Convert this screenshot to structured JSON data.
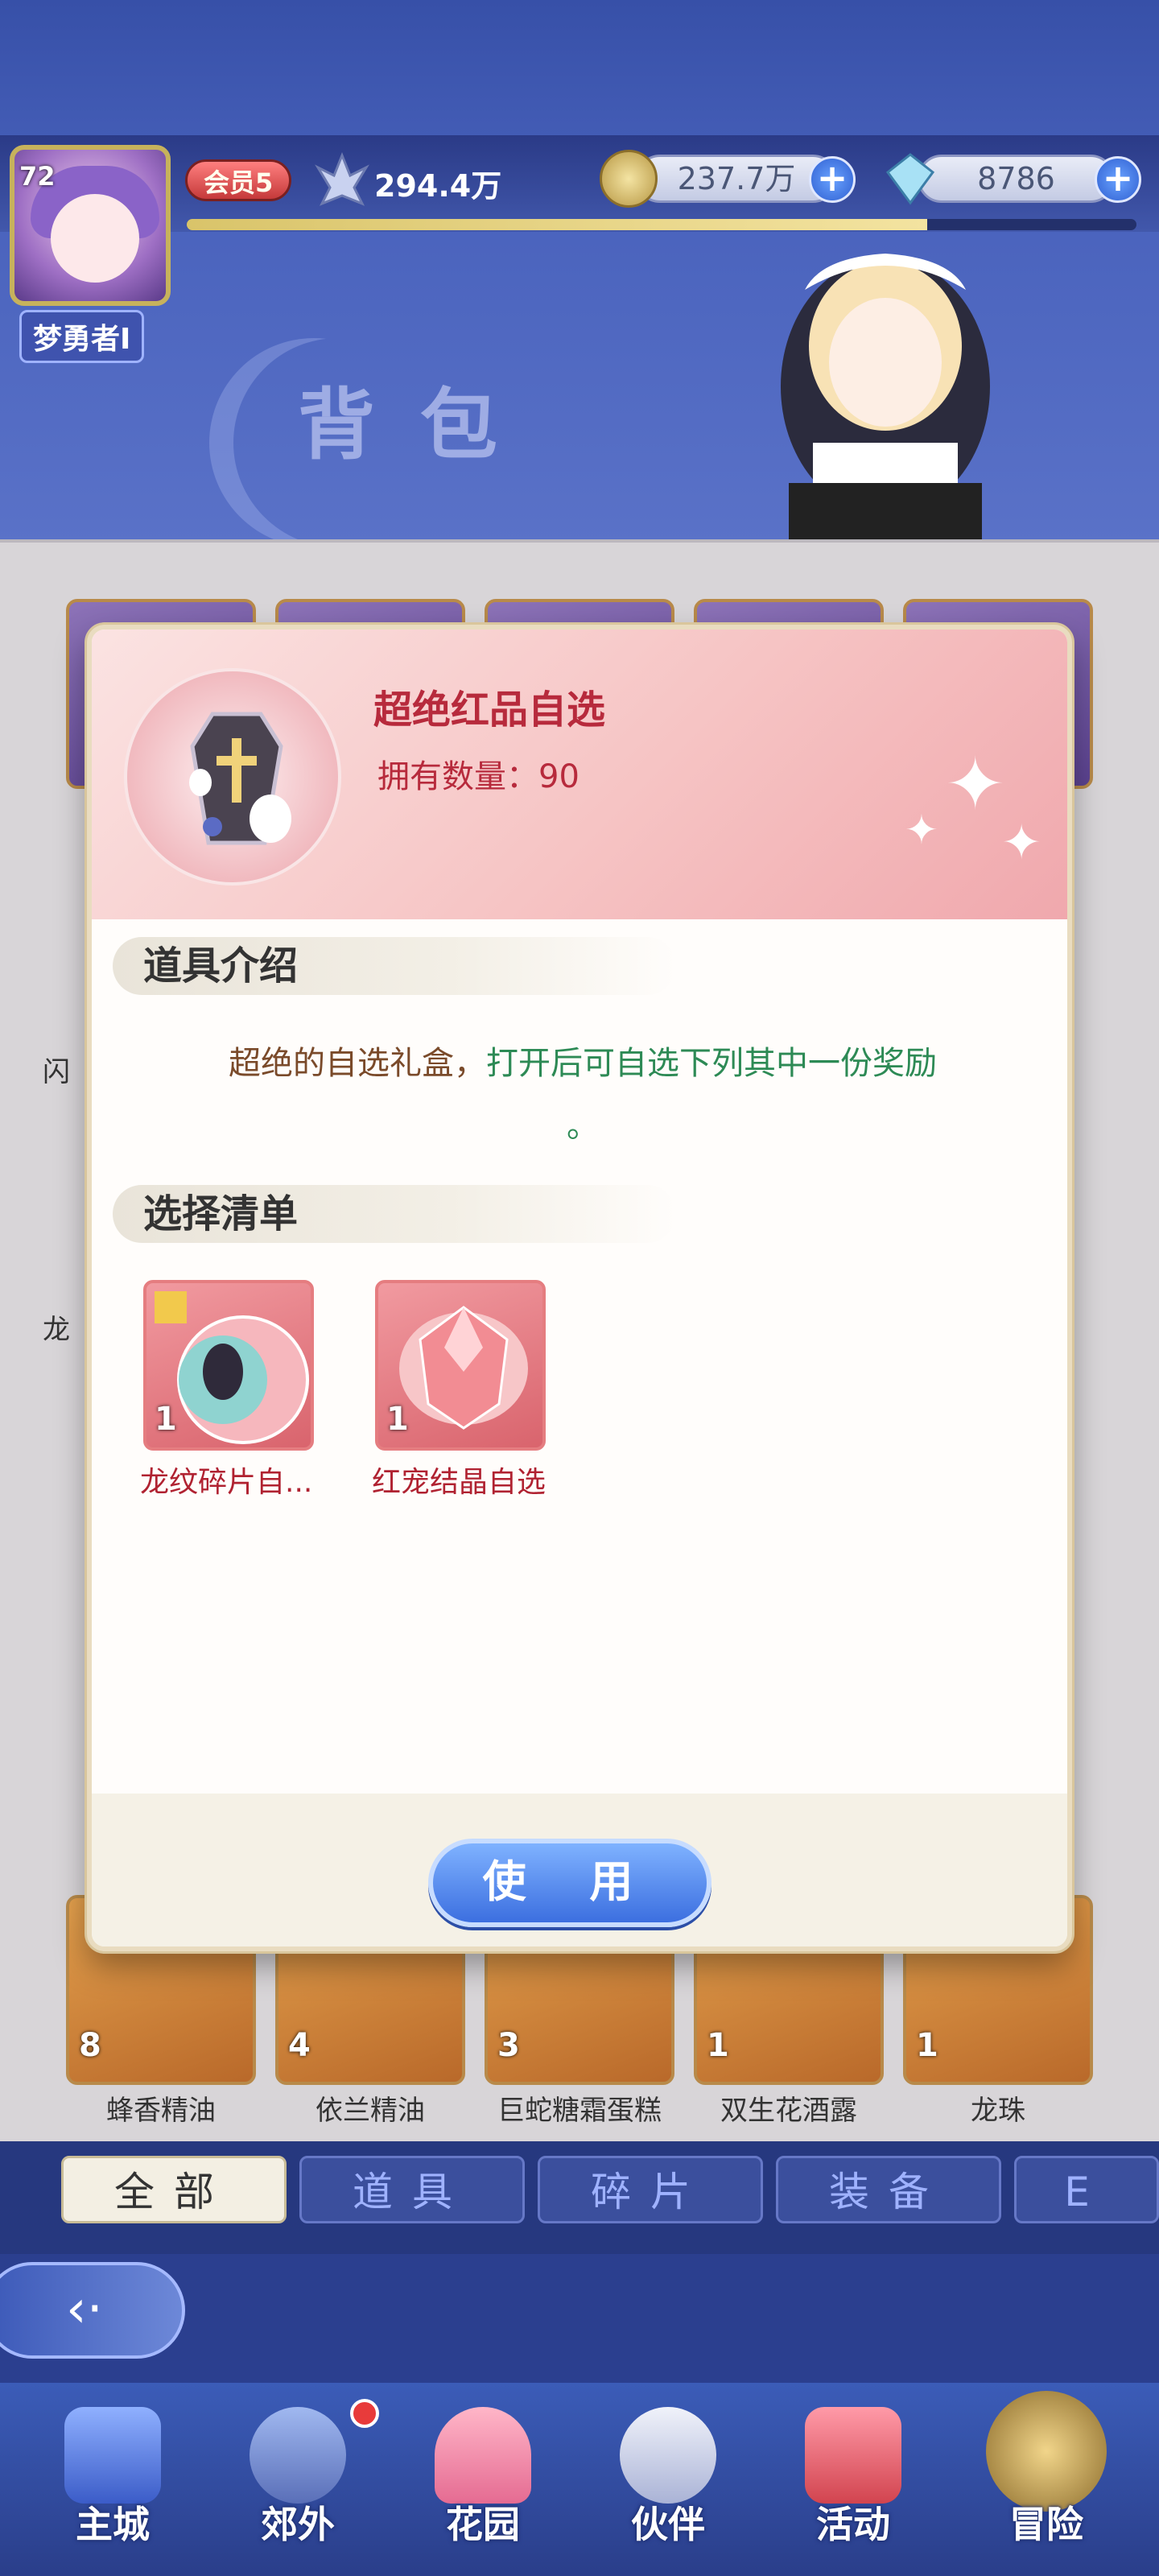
{
  "header": {
    "level": "72",
    "player_name": "梦勇者I",
    "vip": "会员5",
    "power": "294.4万",
    "gold": "237.7万",
    "diamond": "8786",
    "plus": "+",
    "exp_fraction": 0.78,
    "bag_title": "背包"
  },
  "bag_labels": [
    "闪",
    "龙",
    "蜂香精油",
    "依兰精油",
    "巨蛇糖霜蛋糕",
    "双生花酒露",
    "龙珠"
  ],
  "bag_counts": [
    "8",
    "4",
    "3",
    "1",
    "1"
  ],
  "tabs": [
    "全部",
    "道具",
    "碎片",
    "装备",
    "E"
  ],
  "back_label": "‹·",
  "nav": [
    {
      "label": "主城"
    },
    {
      "label": "郊外"
    },
    {
      "label": "花园"
    },
    {
      "label": "伙伴"
    },
    {
      "label": "活动"
    },
    {
      "label": "冒险"
    }
  ],
  "modal": {
    "item_name": "超绝红品自选",
    "count_label": "拥有数量：90",
    "section_intro": "道具介绍",
    "desc_part1": "超绝的自选礼盒，",
    "desc_part2": "打开后可自选下列其中一份奖励",
    "desc_part3": "。",
    "section_list": "选择清单",
    "rewards": [
      {
        "name": "龙纹碎片自...",
        "count": "1"
      },
      {
        "name": "红宠结晶自选",
        "count": "1"
      }
    ],
    "use_button": "使 用"
  },
  "colors": {
    "accent_red": "#b72a3c",
    "desc_green": "#2d8a55",
    "button_blue": "#3c6fe0"
  }
}
